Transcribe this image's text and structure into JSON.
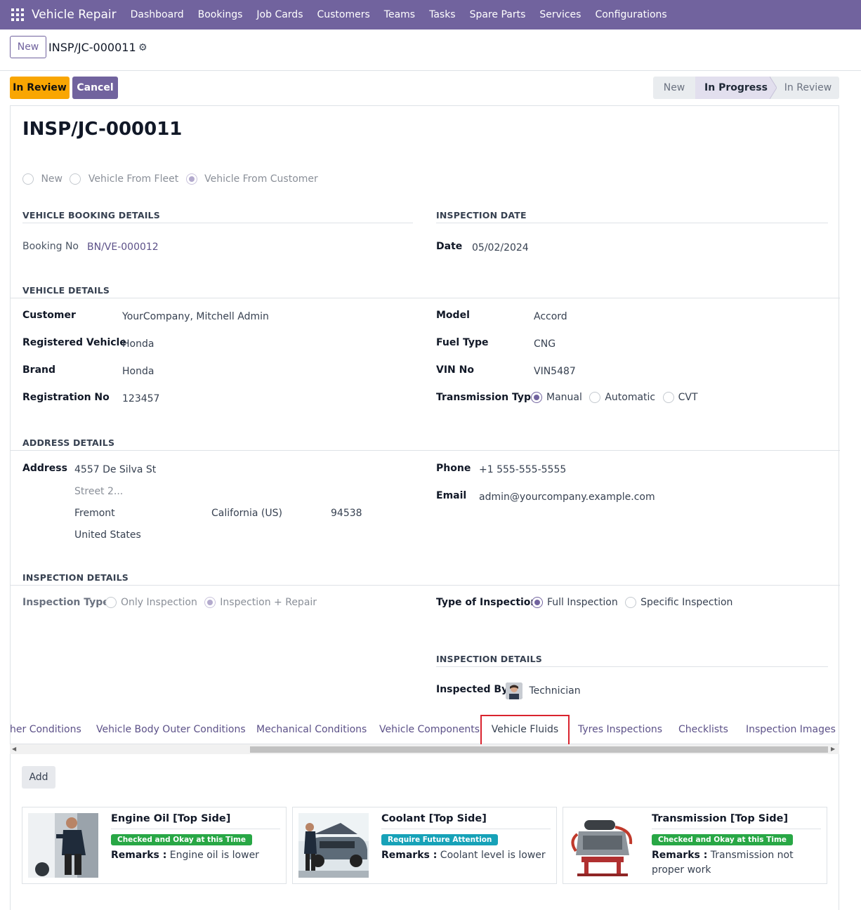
{
  "navbar": {
    "app_name": "Vehicle Repair",
    "menus": [
      "Dashboard",
      "Bookings",
      "Job Cards",
      "Customers",
      "Teams",
      "Tasks",
      "Spare Parts",
      "Services",
      "Configurations"
    ]
  },
  "control_panel": {
    "new_button": "New",
    "breadcrumb": "INSP/JC-000011"
  },
  "actions": {
    "in_review": "In Review",
    "cancel": "Cancel"
  },
  "statusbar": {
    "stages": [
      "New",
      "In Progress",
      "In Review"
    ],
    "active": "In Progress"
  },
  "record": {
    "title": "INSP/JC-000011",
    "vehicle_source": {
      "options": [
        "New",
        "Vehicle From Fleet",
        "Vehicle From Customer"
      ],
      "selected": "Vehicle From Customer"
    },
    "booking": {
      "section": "VEHICLE BOOKING DETAILS",
      "booking_no_label": "Booking No",
      "booking_no": "BN/VE-000012"
    },
    "inspection_date": {
      "section": "INSPECTION DATE",
      "date_label": "Date",
      "date": "05/02/2024"
    },
    "vehicle": {
      "section": "VEHICLE DETAILS",
      "customer_label": "Customer",
      "customer": "YourCompany, Mitchell Admin",
      "registered_vehicle_label": "Registered Vehicle",
      "registered_vehicle": "Honda",
      "brand_label": "Brand",
      "brand": "Honda",
      "registration_no_label": "Registration No",
      "registration_no": "123457",
      "model_label": "Model",
      "model": "Accord",
      "fuel_type_label": "Fuel Type",
      "fuel_type": "CNG",
      "vin_label": "VIN No",
      "vin": "VIN5487",
      "transmission_label": "Transmission Type",
      "transmission_options": [
        "Manual",
        "Automatic",
        "CVT"
      ],
      "transmission_selected": "Manual"
    },
    "address": {
      "section": "ADDRESS DETAILS",
      "address_label": "Address",
      "street": "4557 De Silva St",
      "street2_placeholder": "Street 2...",
      "city": "Fremont",
      "state": "California (US)",
      "zip": "94538",
      "country": "United States",
      "phone_label": "Phone",
      "phone": "+1 555-555-5555",
      "email_label": "Email",
      "email": "admin@yourcompany.example.com"
    },
    "inspection": {
      "section": "INSPECTION DETAILS",
      "type_label": "Inspection Type",
      "type_options": [
        "Only Inspection",
        "Inspection + Repair"
      ],
      "type_selected": "Inspection + Repair",
      "kind_label": "Type of Inspection",
      "kind_options": [
        "Full Inspection",
        "Specific Inspection"
      ],
      "kind_selected": "Full Inspection",
      "sub_section": "INSPECTION DETAILS",
      "inspected_by_label": "Inspected By",
      "inspected_by": "Technician"
    }
  },
  "tabs": {
    "items": [
      "her Conditions",
      "Vehicle Body Outer Conditions",
      "Mechanical Conditions",
      "Vehicle Components",
      "Vehicle Fluids",
      "Tyres Inspections",
      "Checklists",
      "Inspection Images"
    ],
    "active": "Vehicle Fluids"
  },
  "fluids": {
    "add_button": "Add",
    "remarks_label": "Remarks :",
    "cards": [
      {
        "title": "Engine Oil [Top Side]",
        "status": "Checked and Okay at this Time",
        "status_color": "#28a745",
        "remarks": "Engine oil is lower",
        "image": "mechanic-photo"
      },
      {
        "title": "Coolant [Top Side]",
        "status": "Require Future Attention",
        "status_color": "#17a2b8",
        "remarks": "Coolant level is lower",
        "image": "car-hood-photo"
      },
      {
        "title": "Transmission [Top Side]",
        "status": "Checked and Okay at this Time",
        "status_color": "#28a745",
        "remarks": "Transmission not proper work",
        "image": "engine-photo"
      }
    ]
  },
  "colors": {
    "brand": "#71639e",
    "warning": "#f9a602",
    "highlight": "#d9232e"
  }
}
